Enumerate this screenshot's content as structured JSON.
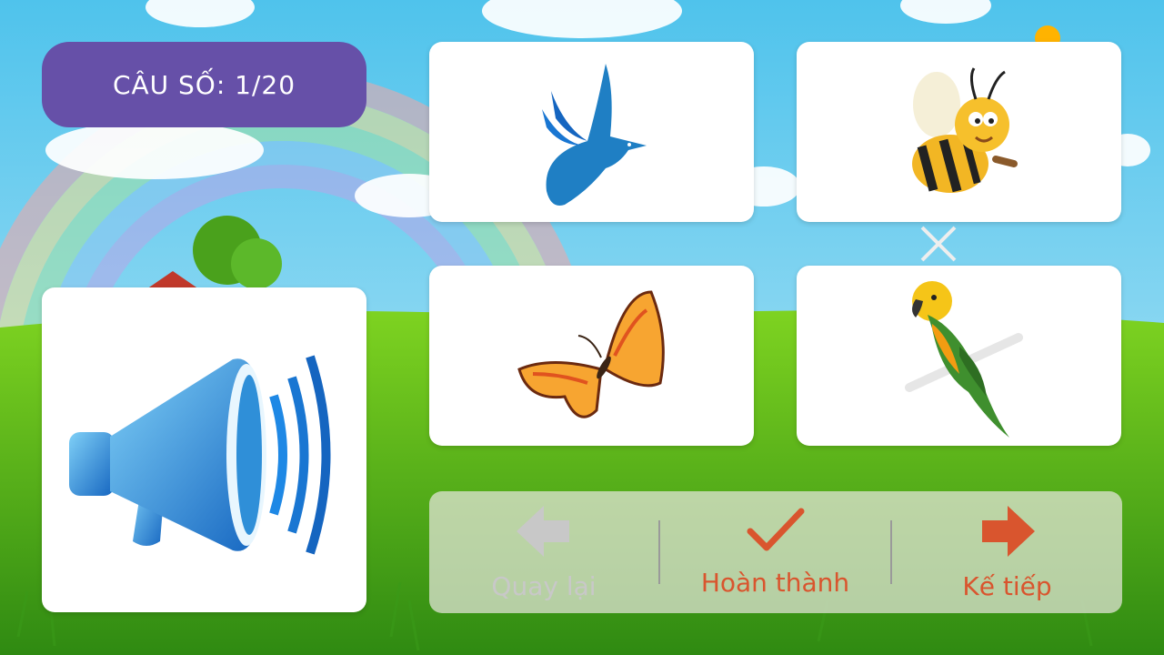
{
  "question": {
    "label": "CÂU SỐ: 1/20"
  },
  "speaker": {
    "icon": "megaphone-icon"
  },
  "options": [
    {
      "icon": "dove-icon"
    },
    {
      "icon": "bee-icon"
    },
    {
      "icon": "butterfly-icon"
    },
    {
      "icon": "parrot-icon"
    }
  ],
  "nav": {
    "back_label": "Quay lại",
    "finish_label": "Hoàn thành",
    "next_label": "Kế tiếp",
    "back_color": "#c8c8c8",
    "accent_color": "#d9552e"
  }
}
